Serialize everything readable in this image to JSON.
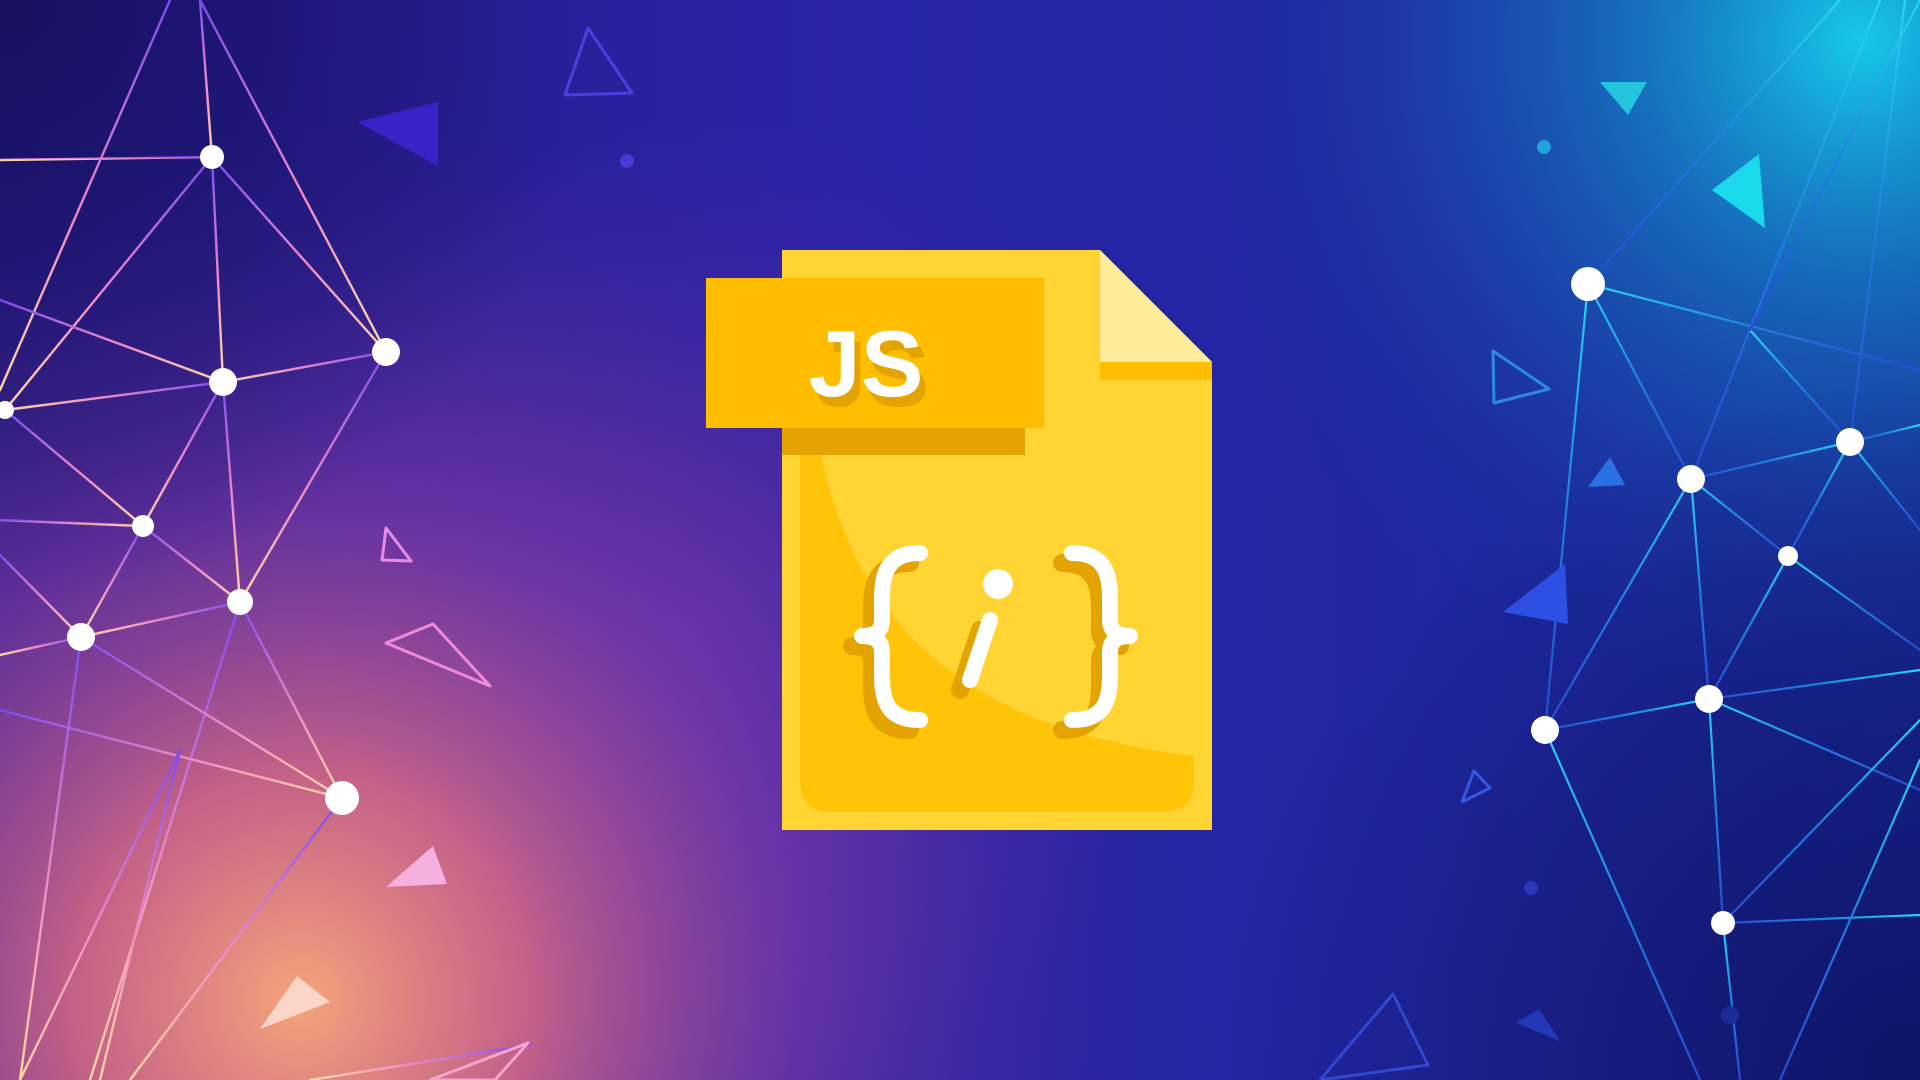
{
  "badge": {
    "label": "JS"
  },
  "file_icon": {
    "symbol": "{;}",
    "semantic": "javascript-file-icon"
  },
  "colors": {
    "background_deep": "#1b1780",
    "background_mid": "#2e2ab0",
    "glow_pink": "#f0857a",
    "glow_cyan": "#19c3e6",
    "file_yellow": "#ffd433",
    "file_shadow": "#e6a500",
    "file_fold": "#ffeb99",
    "badge_orange": "#ffbd00",
    "code_white": "#ffffff"
  }
}
